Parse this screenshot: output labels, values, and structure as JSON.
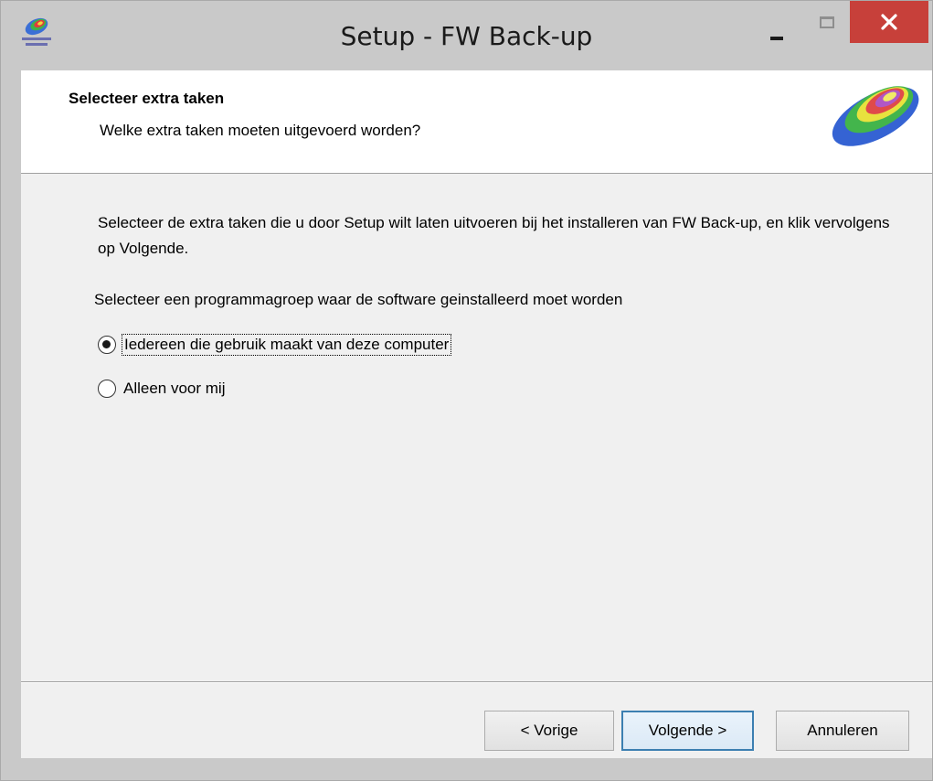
{
  "window": {
    "title": "Setup - FW Back-up",
    "colors": {
      "frame": "#c9c9c9",
      "close_button": "#c7403a",
      "body": "#f0f0f0",
      "header": "#ffffff",
      "default_button_border": "#3c7fb1"
    },
    "controls": {
      "minimize_icon": "minimize-icon",
      "maximize_icon": "maximize-icon",
      "close_icon": "close-icon"
    }
  },
  "header": {
    "title": "Selecteer extra taken",
    "subtitle": "Welke extra taken moeten uitgevoerd worden?"
  },
  "body": {
    "intro": "Selecteer de extra taken die u door Setup wilt laten uitvoeren bij het installeren van FW Back-up, en klik vervolgens op Volgende.",
    "group_label": "Selecteer een programmagroep waar de software geinstalleerd moet worden",
    "options": [
      {
        "label": "Iedereen die gebruik maakt van deze computer",
        "checked": true
      },
      {
        "label": "Alleen voor mij",
        "checked": false
      }
    ]
  },
  "footer": {
    "back_label": "< Vorige",
    "next_label": "Volgende >",
    "cancel_label": "Annuleren"
  }
}
